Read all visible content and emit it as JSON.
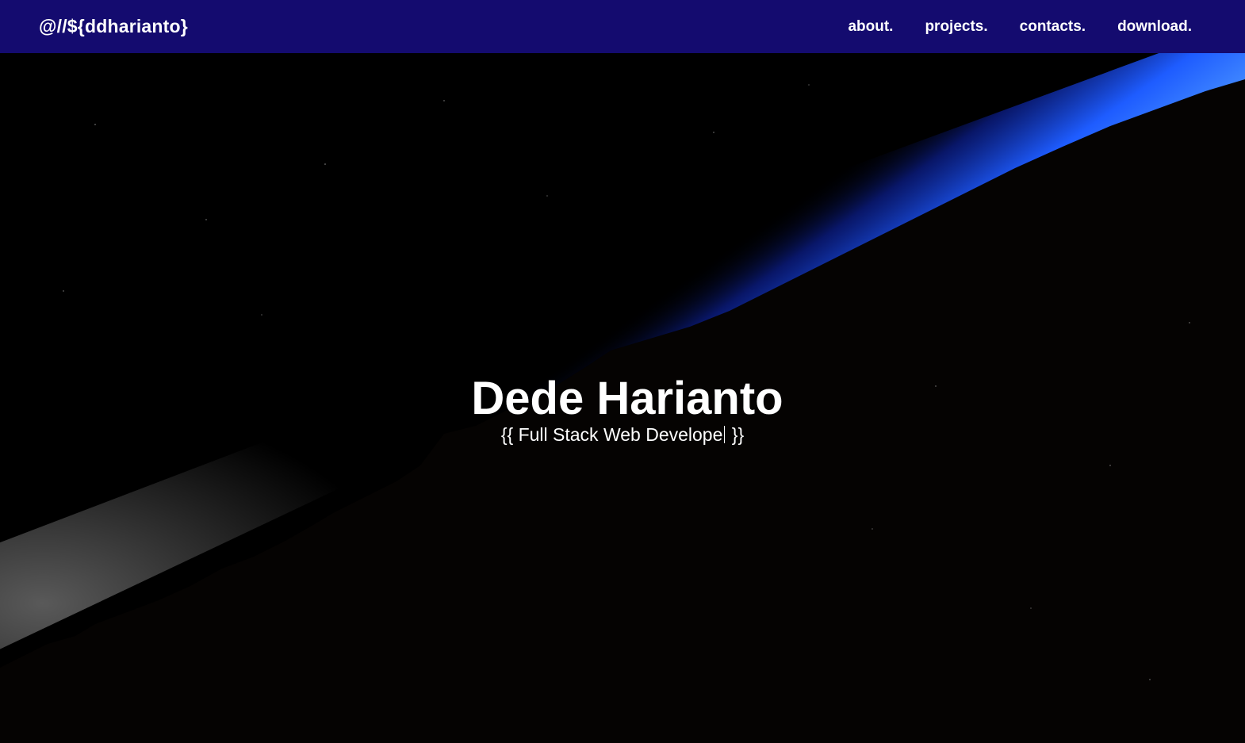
{
  "nav": {
    "brand": "@//${ddharianto}",
    "links": [
      "about.",
      "projects.",
      "contacts.",
      "download."
    ]
  },
  "hero": {
    "name": "Dede Harianto",
    "role_open": "{{ Full Stack Web Develope",
    "role_close": " }}"
  },
  "colors": {
    "navbar": "#140b6f",
    "text": "#ffffff",
    "atmosphere_blue": "#1e6cff",
    "horizon_orange": "#ff9a1f",
    "space": "#000000"
  }
}
